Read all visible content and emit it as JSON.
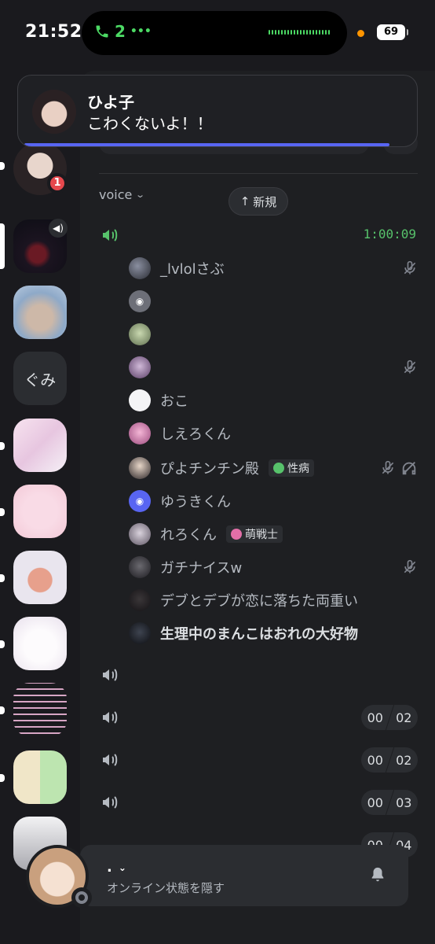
{
  "status_bar": {
    "time": "21:52",
    "call_count": "2",
    "battery": "69"
  },
  "notification": {
    "sender": "ひよ子",
    "message": "こわくないよ！！"
  },
  "rail": {
    "text_server": "ぐみ",
    "mention_count": "1"
  },
  "channel_list": {
    "category": "voice",
    "new_pill": "新規",
    "active_channel": {
      "timer": "1:00:09",
      "members": [
        {
          "name": "_lvlolさぶ",
          "muted": true
        },
        {
          "name": ""
        },
        {
          "name": ""
        },
        {
          "name": "",
          "muted": true
        },
        {
          "name": "おこ"
        },
        {
          "name": "しえろくん"
        },
        {
          "name": "ぴよチンチン殿",
          "role": "性病",
          "muted": true,
          "deafened": true
        },
        {
          "name": "ゆうきくん"
        },
        {
          "name": "れろくん",
          "role": "萌戦士"
        },
        {
          "name": "ガチナイスw",
          "muted": true
        },
        {
          "name": "デブとデブが恋に落ちた両重い"
        },
        {
          "name": "生理中のまんこはおれの大好物",
          "bold": true
        }
      ]
    },
    "other_channels": [
      {
        "left": "",
        "right": ""
      },
      {
        "left": "00",
        "right": "02"
      },
      {
        "left": "00",
        "right": "02"
      },
      {
        "left": "00",
        "right": "03"
      },
      {
        "left": "00",
        "right": "04"
      }
    ]
  },
  "user_panel": {
    "name": ".",
    "status": "オンライン状態を隠す"
  },
  "colors": {
    "accent": "#5865f2",
    "voice_active": "#57c26b",
    "mention": "#e5484d"
  }
}
